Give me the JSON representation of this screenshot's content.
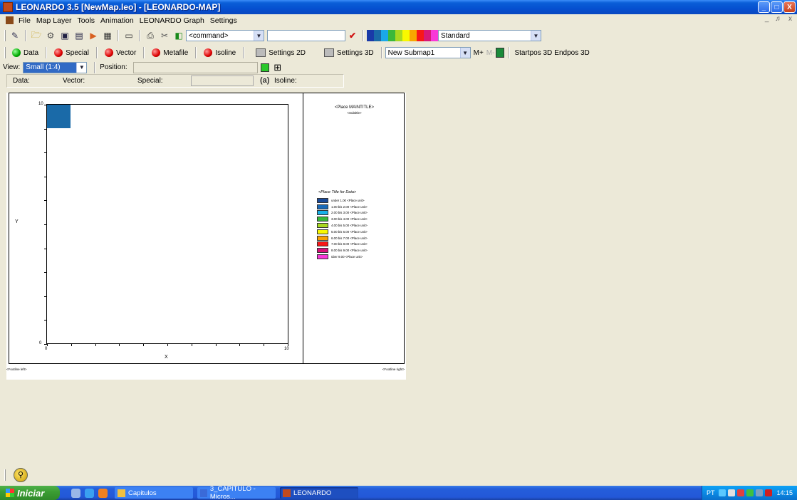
{
  "window": {
    "title": "LEONARDO 3.5 [NewMap.leo] - [LEONARDO-MAP]",
    "controls": {
      "minimize": "_",
      "maximize": "□",
      "close": "X"
    },
    "mdi_controls": "_ ♬ x"
  },
  "menu": [
    "File",
    "Map Layer",
    "Tools",
    "Animation",
    "LEONARDO Graph",
    "Settings"
  ],
  "toolbar1": {
    "command_combo": "<command>",
    "text_input": "",
    "palette_colors": [
      "#1a3aa8",
      "#1a6aa8",
      "#1aa8e8",
      "#3ab83a",
      "#a8d820",
      "#f8f800",
      "#f8a800",
      "#f81818",
      "#d81878",
      "#f838d8"
    ],
    "palette_combo": "Standard"
  },
  "toolbar2": {
    "buttons": [
      {
        "label": "Data",
        "color": "green"
      },
      {
        "label": "Special",
        "color": "red"
      },
      {
        "label": "Vector",
        "color": "red"
      },
      {
        "label": "Metafile",
        "color": "red"
      },
      {
        "label": "Isoline",
        "color": "red"
      }
    ],
    "settings2d": "Settings 2D",
    "settings3d": "Settings 3D",
    "submap_combo": "New Submap1",
    "m_plus": "M+",
    "m_minus": "M-",
    "startpos": "Startpos 3D",
    "endpos": "Endpos 3D"
  },
  "toolbar3": {
    "view_label": "View:",
    "view_combo": "Small (1:4)",
    "position_label": "Position:",
    "position_value": ""
  },
  "toolbar4": {
    "data_label": "Data:",
    "vector_label": "Vector:",
    "special_label": "Special:",
    "special_value": "",
    "isoline_icon": "(a)",
    "isoline_label": "Isoline:"
  },
  "map": {
    "y_axis_label": "Y",
    "x_axis_label": "X",
    "y_top": "10",
    "y_bottom": "0",
    "x_left": "0",
    "x_right": "10",
    "main_title": "<Place MAINTITLE>",
    "subtitle": "<Subtitle>",
    "legend_title": "<Place Title for Data>",
    "legend": [
      {
        "color": "#1a4a98",
        "label": "under 1.00 <Place unit>"
      },
      {
        "color": "#1a6ab8",
        "label": "1.00 bis 2.00 <Place unit>"
      },
      {
        "color": "#18b0e8",
        "label": "2.00 bis 3.00 <Place unit>"
      },
      {
        "color": "#38b838",
        "label": "3.00 bis 4.00 <Place unit>"
      },
      {
        "color": "#a8d820",
        "label": "4.00 bis 5.00 <Place unit>"
      },
      {
        "color": "#f8f800",
        "label": "5.00 bis 6.00 <Place unit>"
      },
      {
        "color": "#f8a000",
        "label": "6.00 bis 7.00 <Place unit>"
      },
      {
        "color": "#f81818",
        "label": "7.00 bis 8.00 <Place unit>"
      },
      {
        "color": "#d8107a",
        "label": "8.00 bis 9.00 <Place unit>"
      },
      {
        "color": "#f838d8",
        "label": "über 9.00 <Place unit>"
      }
    ],
    "footline_left": "<Footline left>",
    "footline_right": "<Footline right>"
  },
  "taskbar": {
    "start_label": "Iniciar",
    "tasks": [
      {
        "label": "Capitulos",
        "icon_color": "#f0c040"
      },
      {
        "label": "3_CAPITULO - Micros...",
        "icon_color": "#3a6ad8"
      },
      {
        "label": "LEONARDO",
        "icon_color": "#c24a1c"
      }
    ],
    "lang": "PT",
    "clock": "14:15"
  }
}
